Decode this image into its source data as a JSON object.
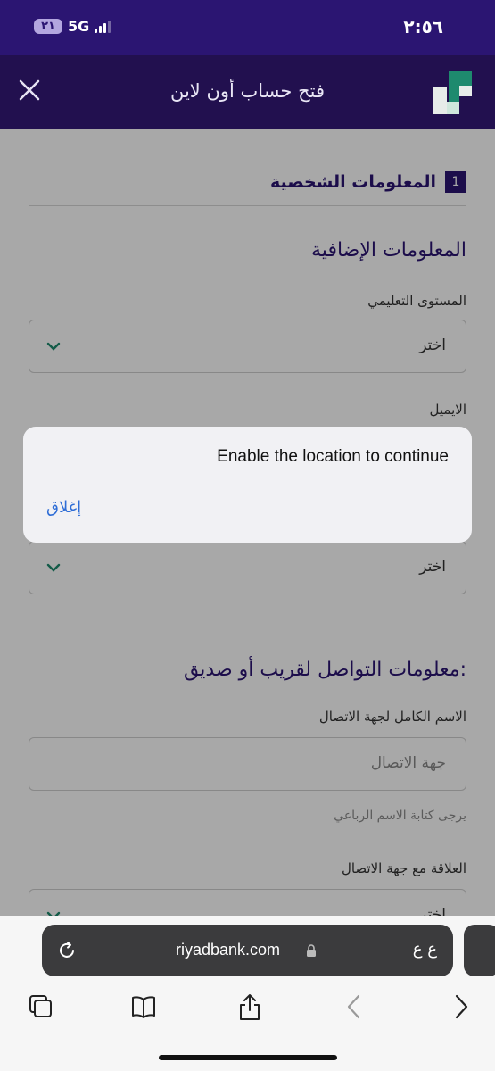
{
  "status_bar": {
    "time": "٢:٥٦",
    "network": "5G",
    "battery": "٢١"
  },
  "header": {
    "title": "فتح حساب أون لاين"
  },
  "section": {
    "step_number": "1",
    "title": "المعلومات الشخصية"
  },
  "additional_info": {
    "heading": "المعلومات الإضافية",
    "education_label": "المستوى التعليمي",
    "education_value": "اختر",
    "email_label": "الايميل",
    "select_value": "اختر"
  },
  "contact_info": {
    "heading": "معلومات التواصل لقريب أو صديق:",
    "fullname_label": "الاسم الكامل لجهة الاتصال",
    "fullname_placeholder": "جهة الاتصال",
    "fullname_hint": "يرجى كتابة الاسم الرباعي",
    "relation_label": "العلاقة مع جهة الاتصال",
    "relation_value": "اختر"
  },
  "alert": {
    "message": "Enable the location to continue",
    "close_label": "إغلاق"
  },
  "browser": {
    "url": "riyadbank.com",
    "text_size_label": "ع ع"
  },
  "colors": {
    "brand": "#2b1572",
    "header": "#22104f",
    "logo_green": "#1e8a6e",
    "link": "#2e6dd6"
  }
}
